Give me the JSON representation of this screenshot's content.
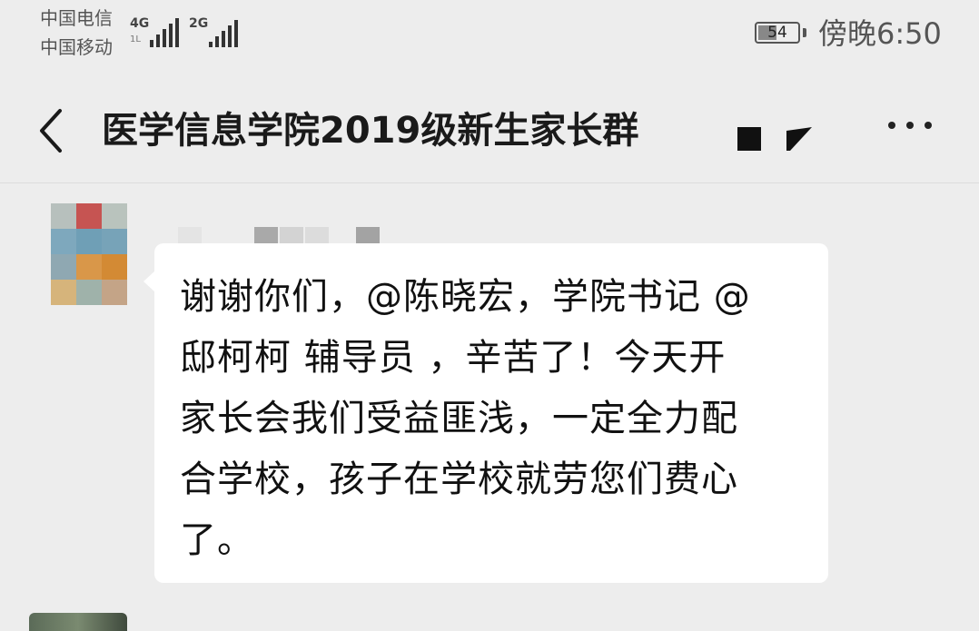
{
  "status_bar": {
    "carrier_1": "中国电信",
    "carrier_2": "中国移动",
    "signal_1_type": "4G",
    "signal_1_sub": "1L",
    "signal_2_type": "2G",
    "battery_level": "54",
    "time": "傍晚6:50"
  },
  "header": {
    "title": "医学信息学院2019级新生家长群"
  },
  "message": {
    "lines": [
      "谢谢你们，@陈晓宏，学院书记 @",
      "邸柯柯 辅导员 ，辛苦了！今天开",
      "家长会我们受益匪浅，一定全力配",
      "合学校，孩子在学校就劳您们费心",
      "了。"
    ]
  },
  "colors": {
    "background": "#ededed",
    "bubble": "#ffffff",
    "text": "#111111"
  }
}
